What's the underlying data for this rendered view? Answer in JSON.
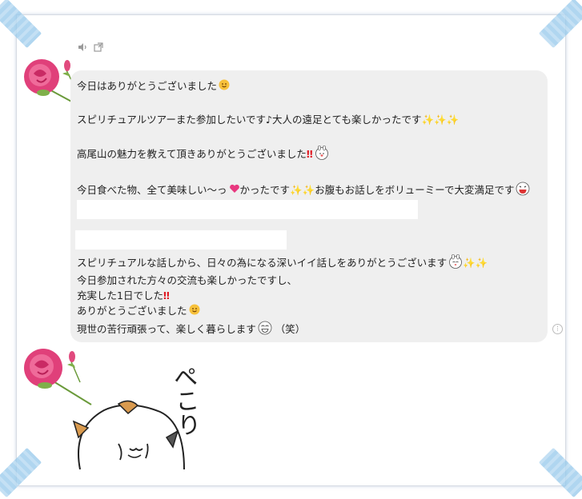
{
  "toolbar": {
    "speaker_icon": "speaker-icon",
    "popout_icon": "popout-icon"
  },
  "message": {
    "lines": [
      "今日はありがとうございました",
      "スピリチュアルツアーまた参加したいです♪大人の遠足とても楽しかったです",
      "高尾山の魅力を教えて頂きありがとうございました",
      "今日食べた物、全て美味しい〜っ",
      "かったです",
      "お腹もお話しをボリューミーで大変満足です",
      "スピリチュアルな話しから、日々の為になる深いイイ話しをありがとうございます",
      "今日参加された方々の交流も楽しかったですし、",
      "充実した1日でした",
      "ありがとうございました",
      "現世の苦行頑張って、楽しく暮らします",
      "（笑）"
    ],
    "sparkles": "✨",
    "exclaim": "‼",
    "note": "♪"
  },
  "sticker_text": "ぺこり",
  "colors": {
    "bubble": "#efefef",
    "frame_border": "#d6dbe3",
    "tape": "#96c8eb",
    "rose": "#e0407a"
  }
}
